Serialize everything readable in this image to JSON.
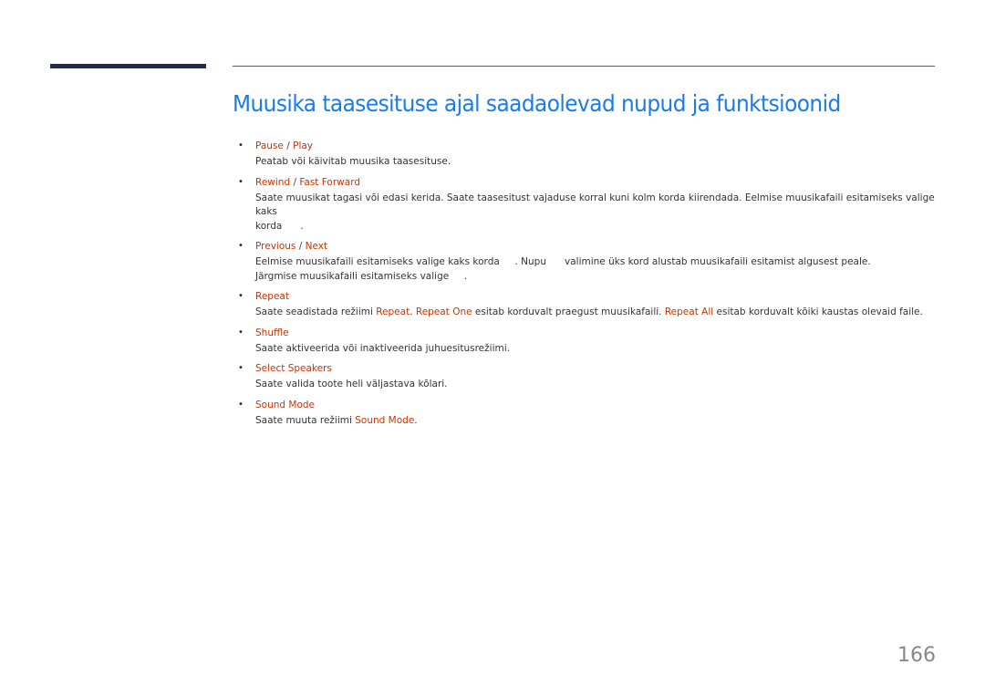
{
  "title": "Muusika taasesituse ajal saadaolevad nupud ja funktsioonid",
  "page_number": "166",
  "items": [
    {
      "head_a": "Pause",
      "sep": " / ",
      "head_b": "Play",
      "desc": "Peatab või käivitab muusika taasesituse."
    },
    {
      "head_a": "Rewind",
      "sep": " / ",
      "head_b": "Fast Forward",
      "desc_1": "Saate muusikat tagasi või edasi kerida. Saate taasesitust vajaduse korral kuni kolm korda kiirendada. Eelmise muusikafaili esitamiseks valige kaks",
      "desc_2": "korda      ."
    },
    {
      "head_a": "Previous",
      "sep": " / ",
      "head_b": "Next",
      "desc_1": "Eelmise muusikafaili esitamiseks valige kaks korda     . Nupu      valimine üks kord alustab muusikafaili esitamist algusest peale.",
      "desc_2": "Järgmise muusikafaili esitamiseks valige     ."
    },
    {
      "head": "Repeat",
      "desc_p1": "Saate seadistada režiimi ",
      "desc_r1": "Repeat",
      "desc_p2": ". ",
      "desc_r2": "Repeat One",
      "desc_p3": " esitab korduvalt praegust muusikafaili. ",
      "desc_r3": "Repeat All",
      "desc_p4": " esitab korduvalt kõiki kaustas olevaid faile."
    },
    {
      "head": "Shuffle",
      "desc": "Saate aktiveerida või inaktiveerida juhuesitusrežiimi."
    },
    {
      "head": "Select Speakers",
      "desc": "Saate valida toote heli väljastava kõlari."
    },
    {
      "head": "Sound Mode",
      "desc_p1": "Saate muuta režiimi ",
      "desc_r1": "Sound Mode",
      "desc_p2": "."
    }
  ]
}
